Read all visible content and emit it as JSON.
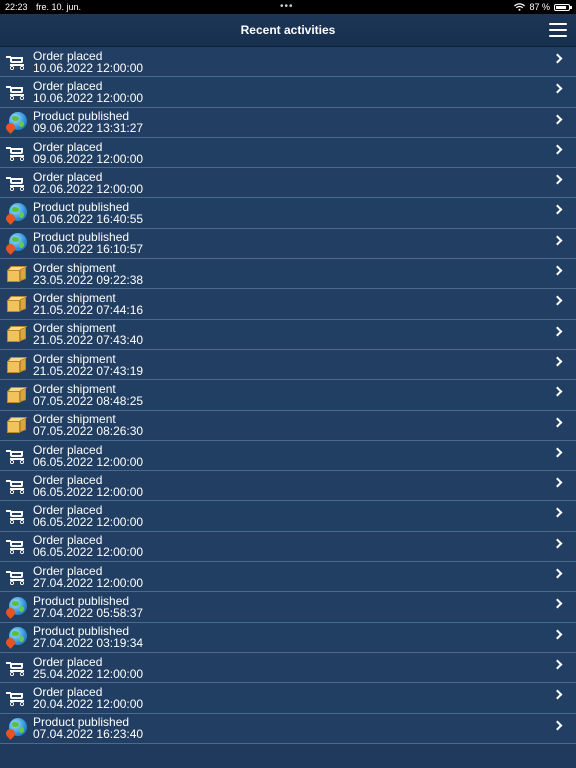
{
  "status_bar": {
    "time": "22:23",
    "date": "fre. 10. jun.",
    "battery": "87 %",
    "battery_level": 0.87
  },
  "header": {
    "title": "Recent activities"
  },
  "activities": [
    {
      "type": "order-placed",
      "title": "Order placed",
      "datetime": "10.06.2022 12:00:00"
    },
    {
      "type": "order-placed",
      "title": "Order placed",
      "datetime": "10.06.2022 12:00:00"
    },
    {
      "type": "product-published",
      "title": "Product published",
      "datetime": "09.06.2022 13:31:27"
    },
    {
      "type": "order-placed",
      "title": "Order placed",
      "datetime": "09.06.2022 12:00:00"
    },
    {
      "type": "order-placed",
      "title": "Order placed",
      "datetime": "02.06.2022 12:00:00"
    },
    {
      "type": "product-published",
      "title": "Product published",
      "datetime": "01.06.2022 16:40:55"
    },
    {
      "type": "product-published",
      "title": "Product published",
      "datetime": "01.06.2022 16:10:57"
    },
    {
      "type": "order-shipment",
      "title": "Order shipment",
      "datetime": "23.05.2022 09:22:38"
    },
    {
      "type": "order-shipment",
      "title": "Order shipment",
      "datetime": "21.05.2022 07:44:16"
    },
    {
      "type": "order-shipment",
      "title": "Order shipment",
      "datetime": "21.05.2022 07:43:40"
    },
    {
      "type": "order-shipment",
      "title": "Order shipment",
      "datetime": "21.05.2022 07:43:19"
    },
    {
      "type": "order-shipment",
      "title": "Order shipment",
      "datetime": "07.05.2022 08:48:25"
    },
    {
      "type": "order-shipment",
      "title": "Order shipment",
      "datetime": "07.05.2022 08:26:30"
    },
    {
      "type": "order-placed",
      "title": "Order placed",
      "datetime": "06.05.2022 12:00:00"
    },
    {
      "type": "order-placed",
      "title": "Order placed",
      "datetime": "06.05.2022 12:00:00"
    },
    {
      "type": "order-placed",
      "title": "Order placed",
      "datetime": "06.05.2022 12:00:00"
    },
    {
      "type": "order-placed",
      "title": "Order placed",
      "datetime": "06.05.2022 12:00:00"
    },
    {
      "type": "order-placed",
      "title": "Order placed",
      "datetime": "27.04.2022 12:00:00"
    },
    {
      "type": "product-published",
      "title": "Product published",
      "datetime": "27.04.2022 05:58:37"
    },
    {
      "type": "product-published",
      "title": "Product published",
      "datetime": "27.04.2022 03:19:34"
    },
    {
      "type": "order-placed",
      "title": "Order placed",
      "datetime": "25.04.2022 12:00:00"
    },
    {
      "type": "order-placed",
      "title": "Order placed",
      "datetime": "20.04.2022 12:00:00"
    },
    {
      "type": "product-published",
      "title": "Product published",
      "datetime": "07.04.2022 16:23:40"
    }
  ]
}
